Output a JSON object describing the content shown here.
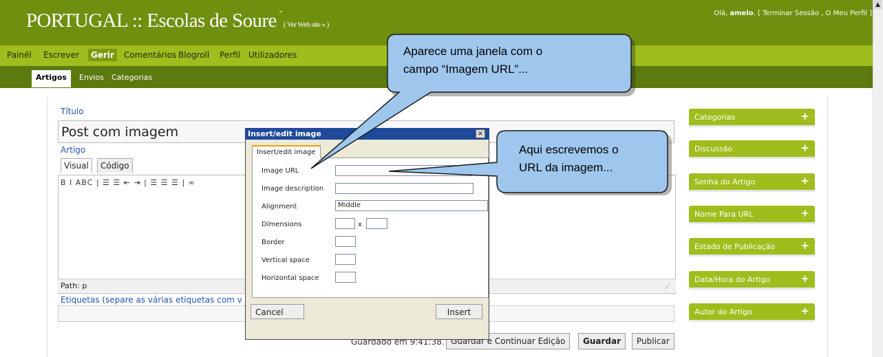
{
  "header": {
    "site_title": "PORTUGAL :: Escolas de Soure",
    "site_arrow": "ˇ",
    "view_site_link": "( Ver Web site » )",
    "greeting": "Olá,",
    "username": "amelo",
    "user_links": ". [ Terminar Sessão , O Meu Perfil ]"
  },
  "nav": {
    "items": [
      {
        "label": "Painél"
      },
      {
        "label": "Escrever"
      },
      {
        "label": "Gerir"
      },
      {
        "label": "Comentários"
      },
      {
        "label": "Blogroll"
      },
      {
        "label": "Perfil"
      },
      {
        "label": "Utilizadores"
      }
    ],
    "active": "Gerir"
  },
  "subnav": {
    "items": [
      {
        "label": "Artigos"
      },
      {
        "label": "Envios"
      },
      {
        "label": "Categorias"
      }
    ],
    "active": "Artigos"
  },
  "editor": {
    "title_label": "Título",
    "title_value": "Post com imagem",
    "article_label": "Artigo",
    "tab_visual": "Visual",
    "tab_code": "Código",
    "toolbar_text": "B I ABC | ☰ ☰ ⇤ ⇥ | ☰ ☰ ☰ | ∞",
    "path_label": "Path: p",
    "tags_label": "Etiquetas (separe as várias etiquetas com v",
    "saved_text": "Guardado em 9:41:38.",
    "save_continue_label": "Guardar e Continuar Edição",
    "save_label": "Guardar",
    "publish_label": "Publicar"
  },
  "sidebar": {
    "boxes": [
      {
        "label": "Categorias",
        "icon": "plus-icon",
        "symbol": "+"
      },
      {
        "label": "Discussão",
        "icon": "plus-icon",
        "symbol": "+"
      },
      {
        "label": "Senha do Artigo",
        "icon": "plus-icon",
        "symbol": "+"
      },
      {
        "label": "Nome Para URL",
        "icon": "plus-icon",
        "symbol": "+"
      },
      {
        "label": "Estado de Publicação",
        "icon": "plus-icon",
        "symbol": "+"
      },
      {
        "label": "Data/Hora do Artigo",
        "icon": "plus-icon",
        "symbol": "+"
      },
      {
        "label": "Autor do Artigo",
        "icon": "plus-icon",
        "symbol": "+"
      }
    ]
  },
  "dialog": {
    "title": "Insert/edit image",
    "close_symbol": "×",
    "tab_label": "Insert/edit image",
    "fields": {
      "image_url_label": "Image URL",
      "image_url_value": "",
      "image_description_label": "Image description",
      "image_description_value": "",
      "alignment_label": "Alignment",
      "alignment_value": "Middle",
      "dimensions_label": "Dimensions",
      "dimensions_x": "x",
      "border_label": "Border",
      "vertical_space_label": "Vertical space",
      "horizontal_space_label": "Horizontal space"
    },
    "cancel_label": "Cancel",
    "insert_label": "Insert"
  },
  "callouts": {
    "top_line1": "Aparece uma janela com o",
    "top_line2": "campo “Imagem URL”...",
    "right_line1": "Aqui escrevemos o",
    "right_line2": "URL da imagem..."
  },
  "colors": {
    "header_bg": "#6f8f0f",
    "nav_bg": "#9fbd1d",
    "subnav_bg": "#5c7a0d",
    "callout_fill": "#9fc7ee",
    "dialog_titlebar": "#1f4a9c"
  }
}
